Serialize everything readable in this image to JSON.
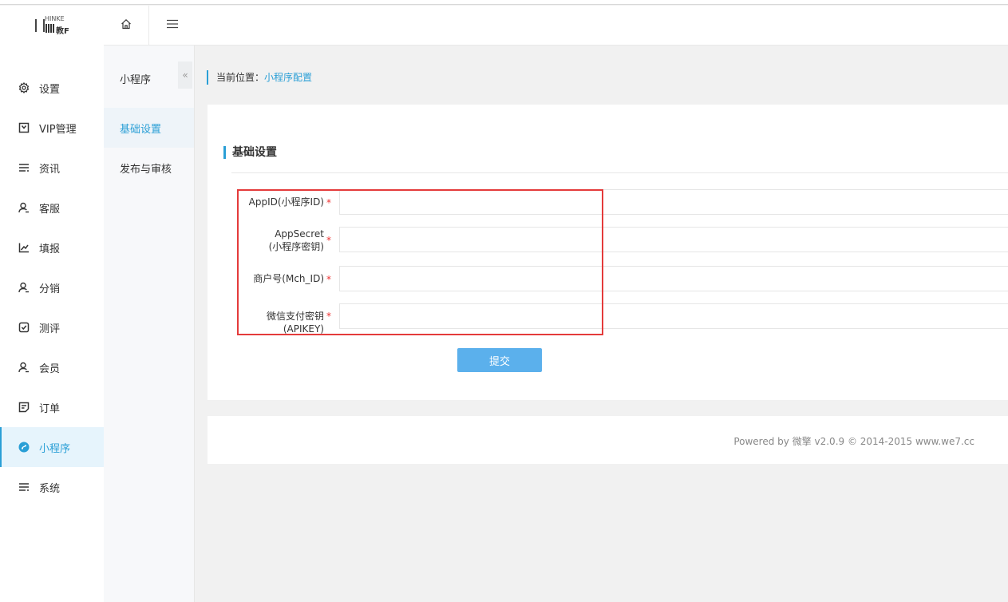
{
  "logo": {
    "text_top": "HINKE",
    "text_bottom": "教F"
  },
  "nav": {
    "items": [
      {
        "label": "设置",
        "icon": "gear-icon"
      },
      {
        "label": "VIP管理",
        "icon": "vip-icon"
      },
      {
        "label": "资讯",
        "icon": "list-icon"
      },
      {
        "label": "客服",
        "icon": "user-icon"
      },
      {
        "label": "填报",
        "icon": "chart-icon"
      },
      {
        "label": "分销",
        "icon": "user-icon"
      },
      {
        "label": "测评",
        "icon": "check-icon"
      },
      {
        "label": "会员",
        "icon": "user-icon"
      },
      {
        "label": "订单",
        "icon": "document-icon"
      },
      {
        "label": "小程序",
        "icon": "miniprogram-icon",
        "active": true
      },
      {
        "label": "系统",
        "icon": "list-icon"
      }
    ]
  },
  "header": {
    "home_icon": "home-icon",
    "menu_icon": "hamburger-icon"
  },
  "submenu": {
    "title": "小程序",
    "collapse_glyph": "«",
    "items": [
      {
        "label": "基础设置",
        "active": true
      },
      {
        "label": "发布与审核"
      }
    ]
  },
  "breadcrumb": {
    "prefix": "当前位置：",
    "current": "小程序配置"
  },
  "form": {
    "title": "基础设置",
    "required_mark": "*",
    "fields": [
      {
        "label_line1": "AppID(小程序ID)",
        "label_line2": "",
        "value": ""
      },
      {
        "label_line1": "AppSecret",
        "label_line2": "(小程序密钥)",
        "value": ""
      },
      {
        "label_line1": "商户号(Mch_ID)",
        "label_line2": "",
        "value": ""
      },
      {
        "label_line1": "微信支付密钥",
        "label_line2": "(APIKEY)",
        "value": ""
      }
    ],
    "submit_label": "提交"
  },
  "footer": {
    "text": "Powered by 微擎 v2.0.9 © 2014-2015 www.we7.cc"
  },
  "colors": {
    "accent": "#2a9fd6",
    "button": "#5bb0ec",
    "highlight_border": "#e43b3b"
  }
}
